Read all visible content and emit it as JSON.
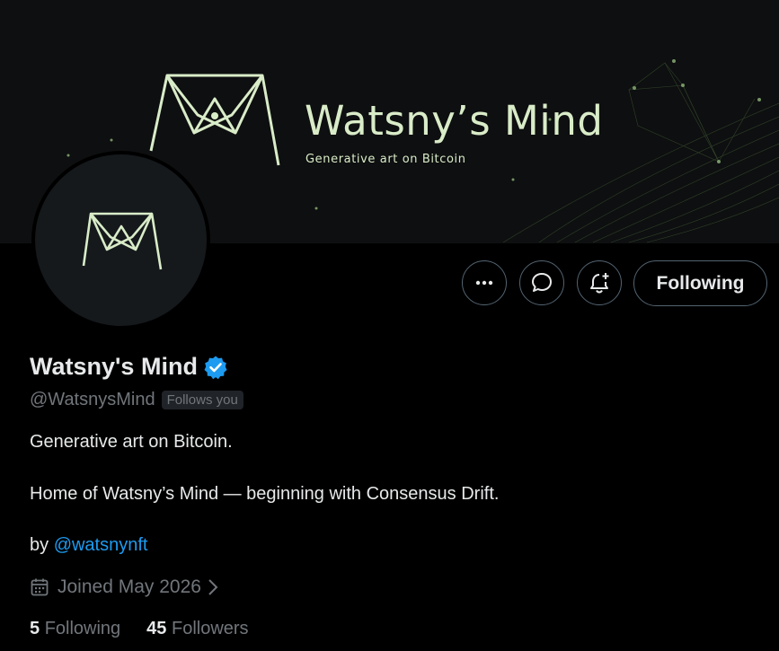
{
  "banner": {
    "title": "Watsny’s Mind",
    "subtitle": "Generative art on Bitcoin"
  },
  "actions": {
    "more_icon": "more-icon",
    "message_icon": "message-icon",
    "notify_icon": "notification-bell-plus-icon",
    "following_label": "Following"
  },
  "profile": {
    "name": "Watsny's Mind",
    "handle": "@WatsnysMind",
    "follows_you": "Follows you",
    "bio_line1": "Generative art on Bitcoin.",
    "bio_line2": "Home of Watsny’s Mind — beginning with Consensus Drift.",
    "by_prefix": "by ",
    "by_mention": "@watsnynft",
    "joined": "Joined May 2026"
  },
  "stats": {
    "following_count": "5",
    "following_label": "Following",
    "followers_count": "45",
    "followers_label": "Followers"
  },
  "colors": {
    "accent": "#1d9bf0",
    "logo": "#d9ecc8",
    "muted": "#71767b"
  }
}
